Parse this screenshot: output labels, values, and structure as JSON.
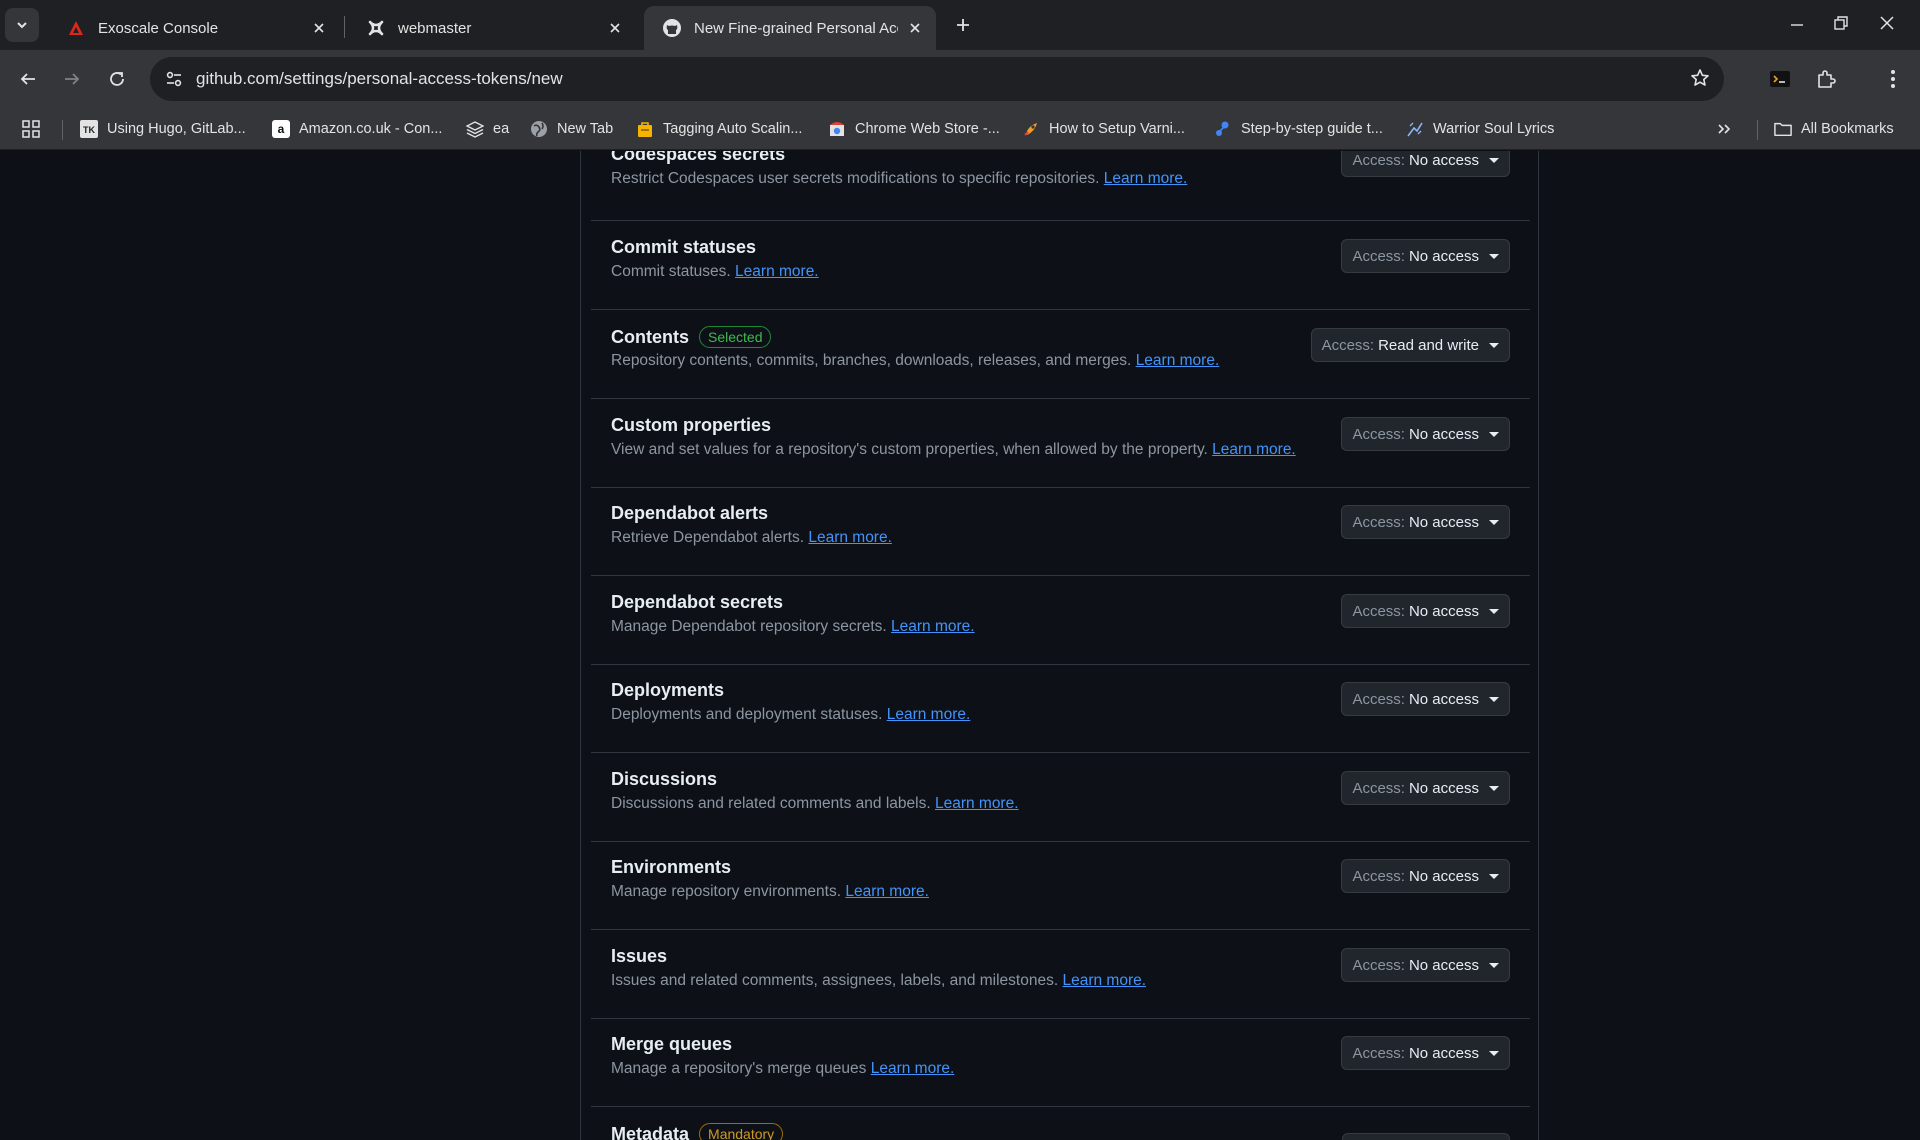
{
  "browser": {
    "tabs": [
      {
        "title": "Exoscale Console",
        "icon": "exoscale-logo-icon"
      },
      {
        "title": "webmaster",
        "icon": "joomla-logo-icon"
      },
      {
        "title": "New Fine-grained Personal Acc",
        "icon": "github-logo-icon"
      }
    ],
    "url": "github.com/settings/personal-access-tokens/new",
    "bookmarks": [
      {
        "label": "Using Hugo, GitLab..."
      },
      {
        "label": "Amazon.co.uk - Con..."
      },
      {
        "label": "ea"
      },
      {
        "label": "New Tab"
      },
      {
        "label": "Tagging Auto Scalin..."
      },
      {
        "label": "Chrome Web Store -..."
      },
      {
        "label": "How to Setup Varni..."
      },
      {
        "label": "Step-by-step guide t..."
      },
      {
        "label": "Warrior Soul Lyrics"
      }
    ],
    "all_bookmarks": "All Bookmarks",
    "colors": {
      "accent_link": "#4493f8",
      "success": "#3fb950",
      "attention": "#d29922"
    }
  },
  "access_label": "Access:",
  "permissions": [
    {
      "name": "Codespaces secrets",
      "badge": "",
      "desc": "Restrict Codespaces user secrets modifications to specific repositories.",
      "link": "Learn more.",
      "access": "No access"
    },
    {
      "name": "Commit statuses",
      "badge": "",
      "desc": "Commit statuses.",
      "link": "Learn more.",
      "access": "No access"
    },
    {
      "name": "Contents",
      "badge": "Selected",
      "desc": "Repository contents, commits, branches, downloads, releases, and merges.",
      "link": "Learn more.",
      "access": "Read and write"
    },
    {
      "name": "Custom properties",
      "badge": "",
      "desc": "View and set values for a repository's custom properties, when allowed by the property.",
      "link": "Learn more.",
      "access": "No access"
    },
    {
      "name": "Dependabot alerts",
      "badge": "",
      "desc": "Retrieve Dependabot alerts.",
      "link": "Learn more.",
      "access": "No access"
    },
    {
      "name": "Dependabot secrets",
      "badge": "",
      "desc": "Manage Dependabot repository secrets.",
      "link": "Learn more.",
      "access": "No access"
    },
    {
      "name": "Deployments",
      "badge": "",
      "desc": "Deployments and deployment statuses.",
      "link": "Learn more.",
      "access": "No access"
    },
    {
      "name": "Discussions",
      "badge": "",
      "desc": "Discussions and related comments and labels.",
      "link": "Learn more.",
      "access": "No access"
    },
    {
      "name": "Environments",
      "badge": "",
      "desc": "Manage repository environments.",
      "link": "Learn more.",
      "access": "No access"
    },
    {
      "name": "Issues",
      "badge": "",
      "desc": "Issues and related comments, assignees, labels, and milestones.",
      "link": "Learn more.",
      "access": "No access"
    },
    {
      "name": "Merge queues",
      "badge": "",
      "desc": "Manage a repository's merge queues",
      "link": "Learn more.",
      "access": "No access"
    },
    {
      "name": "Metadata",
      "badge": "Mandatory",
      "desc": "",
      "link": "",
      "access": ""
    }
  ]
}
